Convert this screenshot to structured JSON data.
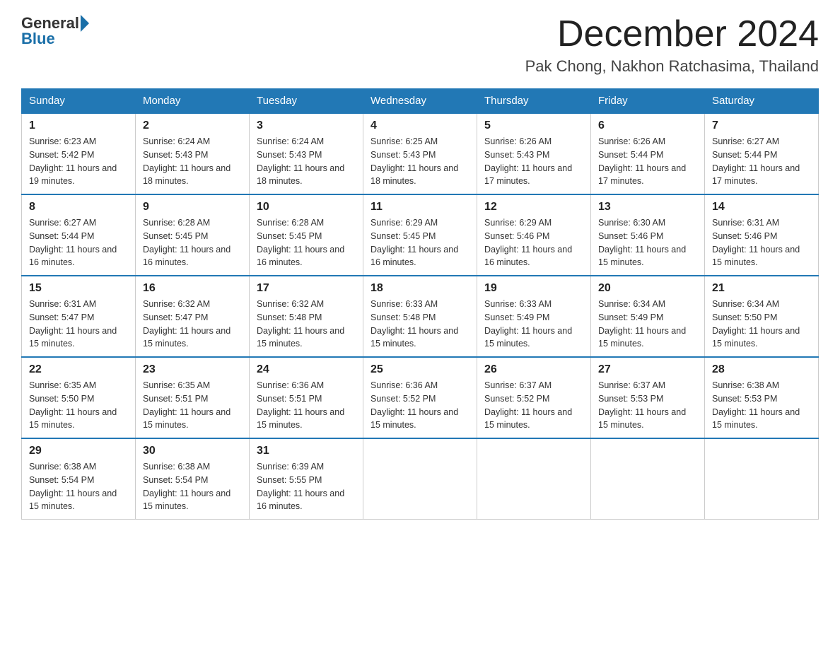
{
  "header": {
    "logo_general": "General",
    "logo_blue": "Blue",
    "month_title": "December 2024",
    "subtitle": "Pak Chong, Nakhon Ratchasima, Thailand"
  },
  "weekdays": [
    "Sunday",
    "Monday",
    "Tuesday",
    "Wednesday",
    "Thursday",
    "Friday",
    "Saturday"
  ],
  "weeks": [
    [
      {
        "day": "1",
        "sunrise": "6:23 AM",
        "sunset": "5:42 PM",
        "daylight": "11 hours and 19 minutes."
      },
      {
        "day": "2",
        "sunrise": "6:24 AM",
        "sunset": "5:43 PM",
        "daylight": "11 hours and 18 minutes."
      },
      {
        "day": "3",
        "sunrise": "6:24 AM",
        "sunset": "5:43 PM",
        "daylight": "11 hours and 18 minutes."
      },
      {
        "day": "4",
        "sunrise": "6:25 AM",
        "sunset": "5:43 PM",
        "daylight": "11 hours and 18 minutes."
      },
      {
        "day": "5",
        "sunrise": "6:26 AM",
        "sunset": "5:43 PM",
        "daylight": "11 hours and 17 minutes."
      },
      {
        "day": "6",
        "sunrise": "6:26 AM",
        "sunset": "5:44 PM",
        "daylight": "11 hours and 17 minutes."
      },
      {
        "day": "7",
        "sunrise": "6:27 AM",
        "sunset": "5:44 PM",
        "daylight": "11 hours and 17 minutes."
      }
    ],
    [
      {
        "day": "8",
        "sunrise": "6:27 AM",
        "sunset": "5:44 PM",
        "daylight": "11 hours and 16 minutes."
      },
      {
        "day": "9",
        "sunrise": "6:28 AM",
        "sunset": "5:45 PM",
        "daylight": "11 hours and 16 minutes."
      },
      {
        "day": "10",
        "sunrise": "6:28 AM",
        "sunset": "5:45 PM",
        "daylight": "11 hours and 16 minutes."
      },
      {
        "day": "11",
        "sunrise": "6:29 AM",
        "sunset": "5:45 PM",
        "daylight": "11 hours and 16 minutes."
      },
      {
        "day": "12",
        "sunrise": "6:29 AM",
        "sunset": "5:46 PM",
        "daylight": "11 hours and 16 minutes."
      },
      {
        "day": "13",
        "sunrise": "6:30 AM",
        "sunset": "5:46 PM",
        "daylight": "11 hours and 15 minutes."
      },
      {
        "day": "14",
        "sunrise": "6:31 AM",
        "sunset": "5:46 PM",
        "daylight": "11 hours and 15 minutes."
      }
    ],
    [
      {
        "day": "15",
        "sunrise": "6:31 AM",
        "sunset": "5:47 PM",
        "daylight": "11 hours and 15 minutes."
      },
      {
        "day": "16",
        "sunrise": "6:32 AM",
        "sunset": "5:47 PM",
        "daylight": "11 hours and 15 minutes."
      },
      {
        "day": "17",
        "sunrise": "6:32 AM",
        "sunset": "5:48 PM",
        "daylight": "11 hours and 15 minutes."
      },
      {
        "day": "18",
        "sunrise": "6:33 AM",
        "sunset": "5:48 PM",
        "daylight": "11 hours and 15 minutes."
      },
      {
        "day": "19",
        "sunrise": "6:33 AM",
        "sunset": "5:49 PM",
        "daylight": "11 hours and 15 minutes."
      },
      {
        "day": "20",
        "sunrise": "6:34 AM",
        "sunset": "5:49 PM",
        "daylight": "11 hours and 15 minutes."
      },
      {
        "day": "21",
        "sunrise": "6:34 AM",
        "sunset": "5:50 PM",
        "daylight": "11 hours and 15 minutes."
      }
    ],
    [
      {
        "day": "22",
        "sunrise": "6:35 AM",
        "sunset": "5:50 PM",
        "daylight": "11 hours and 15 minutes."
      },
      {
        "day": "23",
        "sunrise": "6:35 AM",
        "sunset": "5:51 PM",
        "daylight": "11 hours and 15 minutes."
      },
      {
        "day": "24",
        "sunrise": "6:36 AM",
        "sunset": "5:51 PM",
        "daylight": "11 hours and 15 minutes."
      },
      {
        "day": "25",
        "sunrise": "6:36 AM",
        "sunset": "5:52 PM",
        "daylight": "11 hours and 15 minutes."
      },
      {
        "day": "26",
        "sunrise": "6:37 AM",
        "sunset": "5:52 PM",
        "daylight": "11 hours and 15 minutes."
      },
      {
        "day": "27",
        "sunrise": "6:37 AM",
        "sunset": "5:53 PM",
        "daylight": "11 hours and 15 minutes."
      },
      {
        "day": "28",
        "sunrise": "6:38 AM",
        "sunset": "5:53 PM",
        "daylight": "11 hours and 15 minutes."
      }
    ],
    [
      {
        "day": "29",
        "sunrise": "6:38 AM",
        "sunset": "5:54 PM",
        "daylight": "11 hours and 15 minutes."
      },
      {
        "day": "30",
        "sunrise": "6:38 AM",
        "sunset": "5:54 PM",
        "daylight": "11 hours and 15 minutes."
      },
      {
        "day": "31",
        "sunrise": "6:39 AM",
        "sunset": "5:55 PM",
        "daylight": "11 hours and 16 minutes."
      },
      null,
      null,
      null,
      null
    ]
  ]
}
